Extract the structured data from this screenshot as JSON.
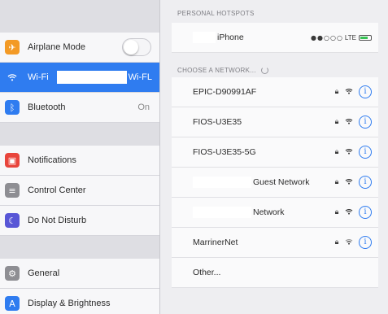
{
  "sidebar": {
    "airplane": {
      "label": "Airplane Mode",
      "icon": "airplane-icon",
      "color": "#f39a26",
      "enabled": false
    },
    "wifi": {
      "label": "Wi-Fi",
      "value_suffix": "Wi-FL",
      "icon": "wifi-icon",
      "color": "#2f7cf0"
    },
    "bluetooth": {
      "label": "Bluetooth",
      "value": "On",
      "icon": "bluetooth-icon",
      "color": "#2f7cf0"
    },
    "notifications": {
      "label": "Notifications",
      "icon": "notifications-icon",
      "color": "#e8453c"
    },
    "control_center": {
      "label": "Control Center",
      "icon": "control-center-icon",
      "color": "#8e8e93"
    },
    "do_not_disturb": {
      "label": "Do Not Disturb",
      "icon": "moon-icon",
      "color": "#5856d6"
    },
    "general": {
      "label": "General",
      "icon": "gear-icon",
      "color": "#8e8e93"
    },
    "display": {
      "label": "Display & Brightness",
      "icon": "display-brightness-icon",
      "color": "#2f7cf0"
    }
  },
  "detail": {
    "personal_hotspots_header": "PERSONAL HOTSPOTS",
    "hotspot": {
      "name_suffix": "iPhone",
      "network": "LTE"
    },
    "choose_header": "CHOOSE A NETWORK...",
    "networks": [
      {
        "name": "EPIC-D90991AF"
      },
      {
        "name": "FIOS-U3E35"
      },
      {
        "name": "FIOS-U3E35-5G"
      },
      {
        "name": "Guest Network",
        "redacted_prefix": true
      },
      {
        "name": "Network",
        "redacted_prefix": true
      },
      {
        "name": "MarrinerNet"
      }
    ],
    "other": "Other..."
  },
  "colors": {
    "accent": "#2f7cf0",
    "battery": "#37c254"
  }
}
